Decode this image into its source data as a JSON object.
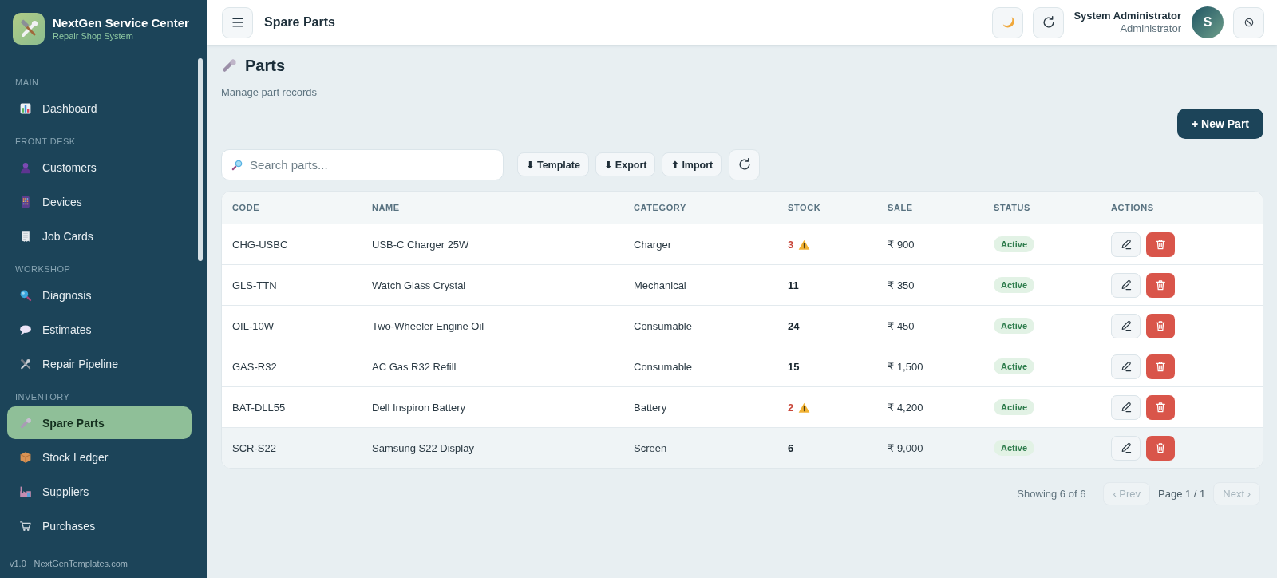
{
  "sidebar": {
    "brand": {
      "title": "NextGen Service Center",
      "subtitle": "Repair Shop System"
    },
    "sections": [
      {
        "label": "MAIN",
        "items": [
          {
            "label": "Dashboard",
            "selected": false
          }
        ]
      },
      {
        "label": "FRONT DESK",
        "items": [
          {
            "label": "Customers",
            "selected": false
          },
          {
            "label": "Devices",
            "selected": false
          },
          {
            "label": "Job Cards",
            "selected": false
          }
        ]
      },
      {
        "label": "WORKSHOP",
        "items": [
          {
            "label": "Diagnosis",
            "selected": false
          },
          {
            "label": "Estimates",
            "selected": false
          },
          {
            "label": "Repair Pipeline",
            "selected": false
          }
        ]
      },
      {
        "label": "INVENTORY",
        "items": [
          {
            "label": "Spare Parts",
            "selected": true
          },
          {
            "label": "Stock Ledger",
            "selected": false
          },
          {
            "label": "Suppliers",
            "selected": false
          },
          {
            "label": "Purchases",
            "selected": false
          }
        ]
      }
    ],
    "footer": "v1.0 · NextGenTemplates.com"
  },
  "topbar": {
    "title": "Spare Parts",
    "user": {
      "name": "System Administrator",
      "role": "Administrator",
      "initial": "S"
    }
  },
  "page": {
    "title": "Parts",
    "subtitle": "Manage part records",
    "new_button": "+ New Part"
  },
  "toolbar": {
    "search": {
      "placeholder": "Search parts..."
    },
    "buttons": [
      "⬇ Template",
      "⬇ Export",
      "⬆ Import"
    ]
  },
  "table": {
    "columns": [
      "CODE",
      "NAME",
      "CATEGORY",
      "STOCK",
      "SALE",
      "STATUS",
      "ACTIONS"
    ],
    "rows": [
      {
        "code": "CHG-USBC",
        "name": "USB-C Charger 25W",
        "category": "Charger",
        "stock": "3",
        "low_stock": true,
        "sale": "₹ 900",
        "status": "Active",
        "hovered": false
      },
      {
        "code": "GLS-TTN",
        "name": "Watch Glass Crystal",
        "category": "Mechanical",
        "stock": "11",
        "low_stock": false,
        "sale": "₹ 350",
        "status": "Active",
        "hovered": false
      },
      {
        "code": "OIL-10W",
        "name": "Two-Wheeler Engine Oil",
        "category": "Consumable",
        "stock": "24",
        "low_stock": false,
        "sale": "₹ 450",
        "status": "Active",
        "hovered": false
      },
      {
        "code": "GAS-R32",
        "name": "AC Gas R32 Refill",
        "category": "Consumable",
        "stock": "15",
        "low_stock": false,
        "sale": "₹ 1,500",
        "status": "Active",
        "hovered": false
      },
      {
        "code": "BAT-DLL55",
        "name": "Dell Inspiron Battery",
        "category": "Battery",
        "stock": "2",
        "low_stock": true,
        "sale": "₹ 4,200",
        "status": "Active",
        "hovered": false
      },
      {
        "code": "SCR-S22",
        "name": "Samsung S22 Display",
        "category": "Screen",
        "stock": "6",
        "low_stock": false,
        "sale": "₹ 9,000",
        "status": "Active",
        "hovered": true
      }
    ]
  },
  "pagination": {
    "summary": "Showing 6 of 6",
    "prev": {
      "label": "‹ Prev",
      "disabled": true
    },
    "page": "Page 1 / 1",
    "next": {
      "label": "Next ›",
      "disabled": true
    }
  }
}
